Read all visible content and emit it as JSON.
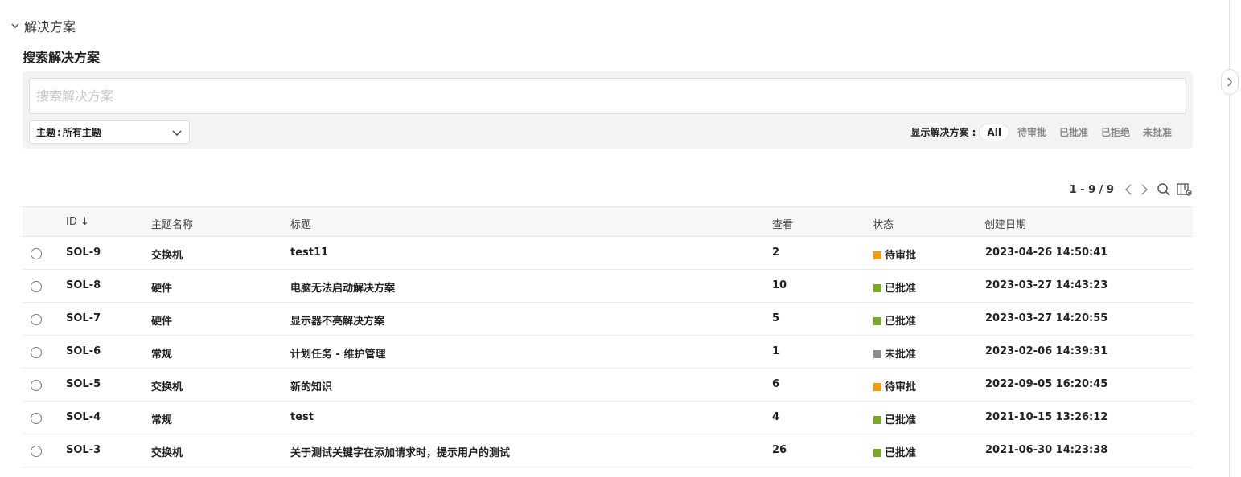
{
  "section": {
    "title": "解决方案"
  },
  "search": {
    "heading": "搜索解决方案",
    "placeholder": "搜索解决方案",
    "topic_label": "主题",
    "topic_value": "所有主题"
  },
  "filters": {
    "label": "显示解决方案 :",
    "options": [
      "All",
      "待审批",
      "已批准",
      "已拒绝",
      "未批准"
    ],
    "selected": "All"
  },
  "pager": {
    "range": "1 - 9 / 9"
  },
  "table": {
    "columns": {
      "id": "ID ↓",
      "topic": "主题名称",
      "title": "标题",
      "views": "查看",
      "status": "状态",
      "created": "创建日期"
    },
    "rows": [
      {
        "id": "SOL-9",
        "topic": "交换机",
        "title": "test11",
        "views": "2",
        "status": "待审批",
        "status_color": "#f39c12",
        "created": "2023-04-26 14:50:41"
      },
      {
        "id": "SOL-8",
        "topic": "硬件",
        "title": "电脑无法启动解决方案",
        "views": "10",
        "status": "已批准",
        "status_color": "#7aa82a",
        "created": "2023-03-27 14:43:23"
      },
      {
        "id": "SOL-7",
        "topic": "硬件",
        "title": "显示器不亮解决方案",
        "views": "5",
        "status": "已批准",
        "status_color": "#7aa82a",
        "created": "2023-03-27 14:20:55"
      },
      {
        "id": "SOL-6",
        "topic": "常规",
        "title": "计划任务 - 维护管理",
        "views": "1",
        "status": "未批准",
        "status_color": "#8c8c8c",
        "created": "2023-02-06 14:39:31"
      },
      {
        "id": "SOL-5",
        "topic": "交换机",
        "title": "新的知识",
        "views": "6",
        "status": "待审批",
        "status_color": "#f39c12",
        "created": "2022-09-05 16:20:45"
      },
      {
        "id": "SOL-4",
        "topic": "常规",
        "title": "test",
        "views": "4",
        "status": "已批准",
        "status_color": "#7aa82a",
        "created": "2021-10-15 13:26:12"
      },
      {
        "id": "SOL-3",
        "topic": "交换机",
        "title": "关于测试关键字在添加请求时，提示用户的测试",
        "views": "26",
        "status": "已批准",
        "status_color": "#7aa82a",
        "created": "2021-06-30 14:23:38"
      }
    ]
  },
  "icons": {
    "section_toggle": "chevron-down-icon",
    "topic_dropdown": "chevron-down-icon",
    "pager_prev": "chevron-left-icon",
    "pager_next": "chevron-right-icon",
    "table_search": "search-icon",
    "column_settings": "column-settings-icon",
    "side_panel": "chevron-right-icon"
  }
}
